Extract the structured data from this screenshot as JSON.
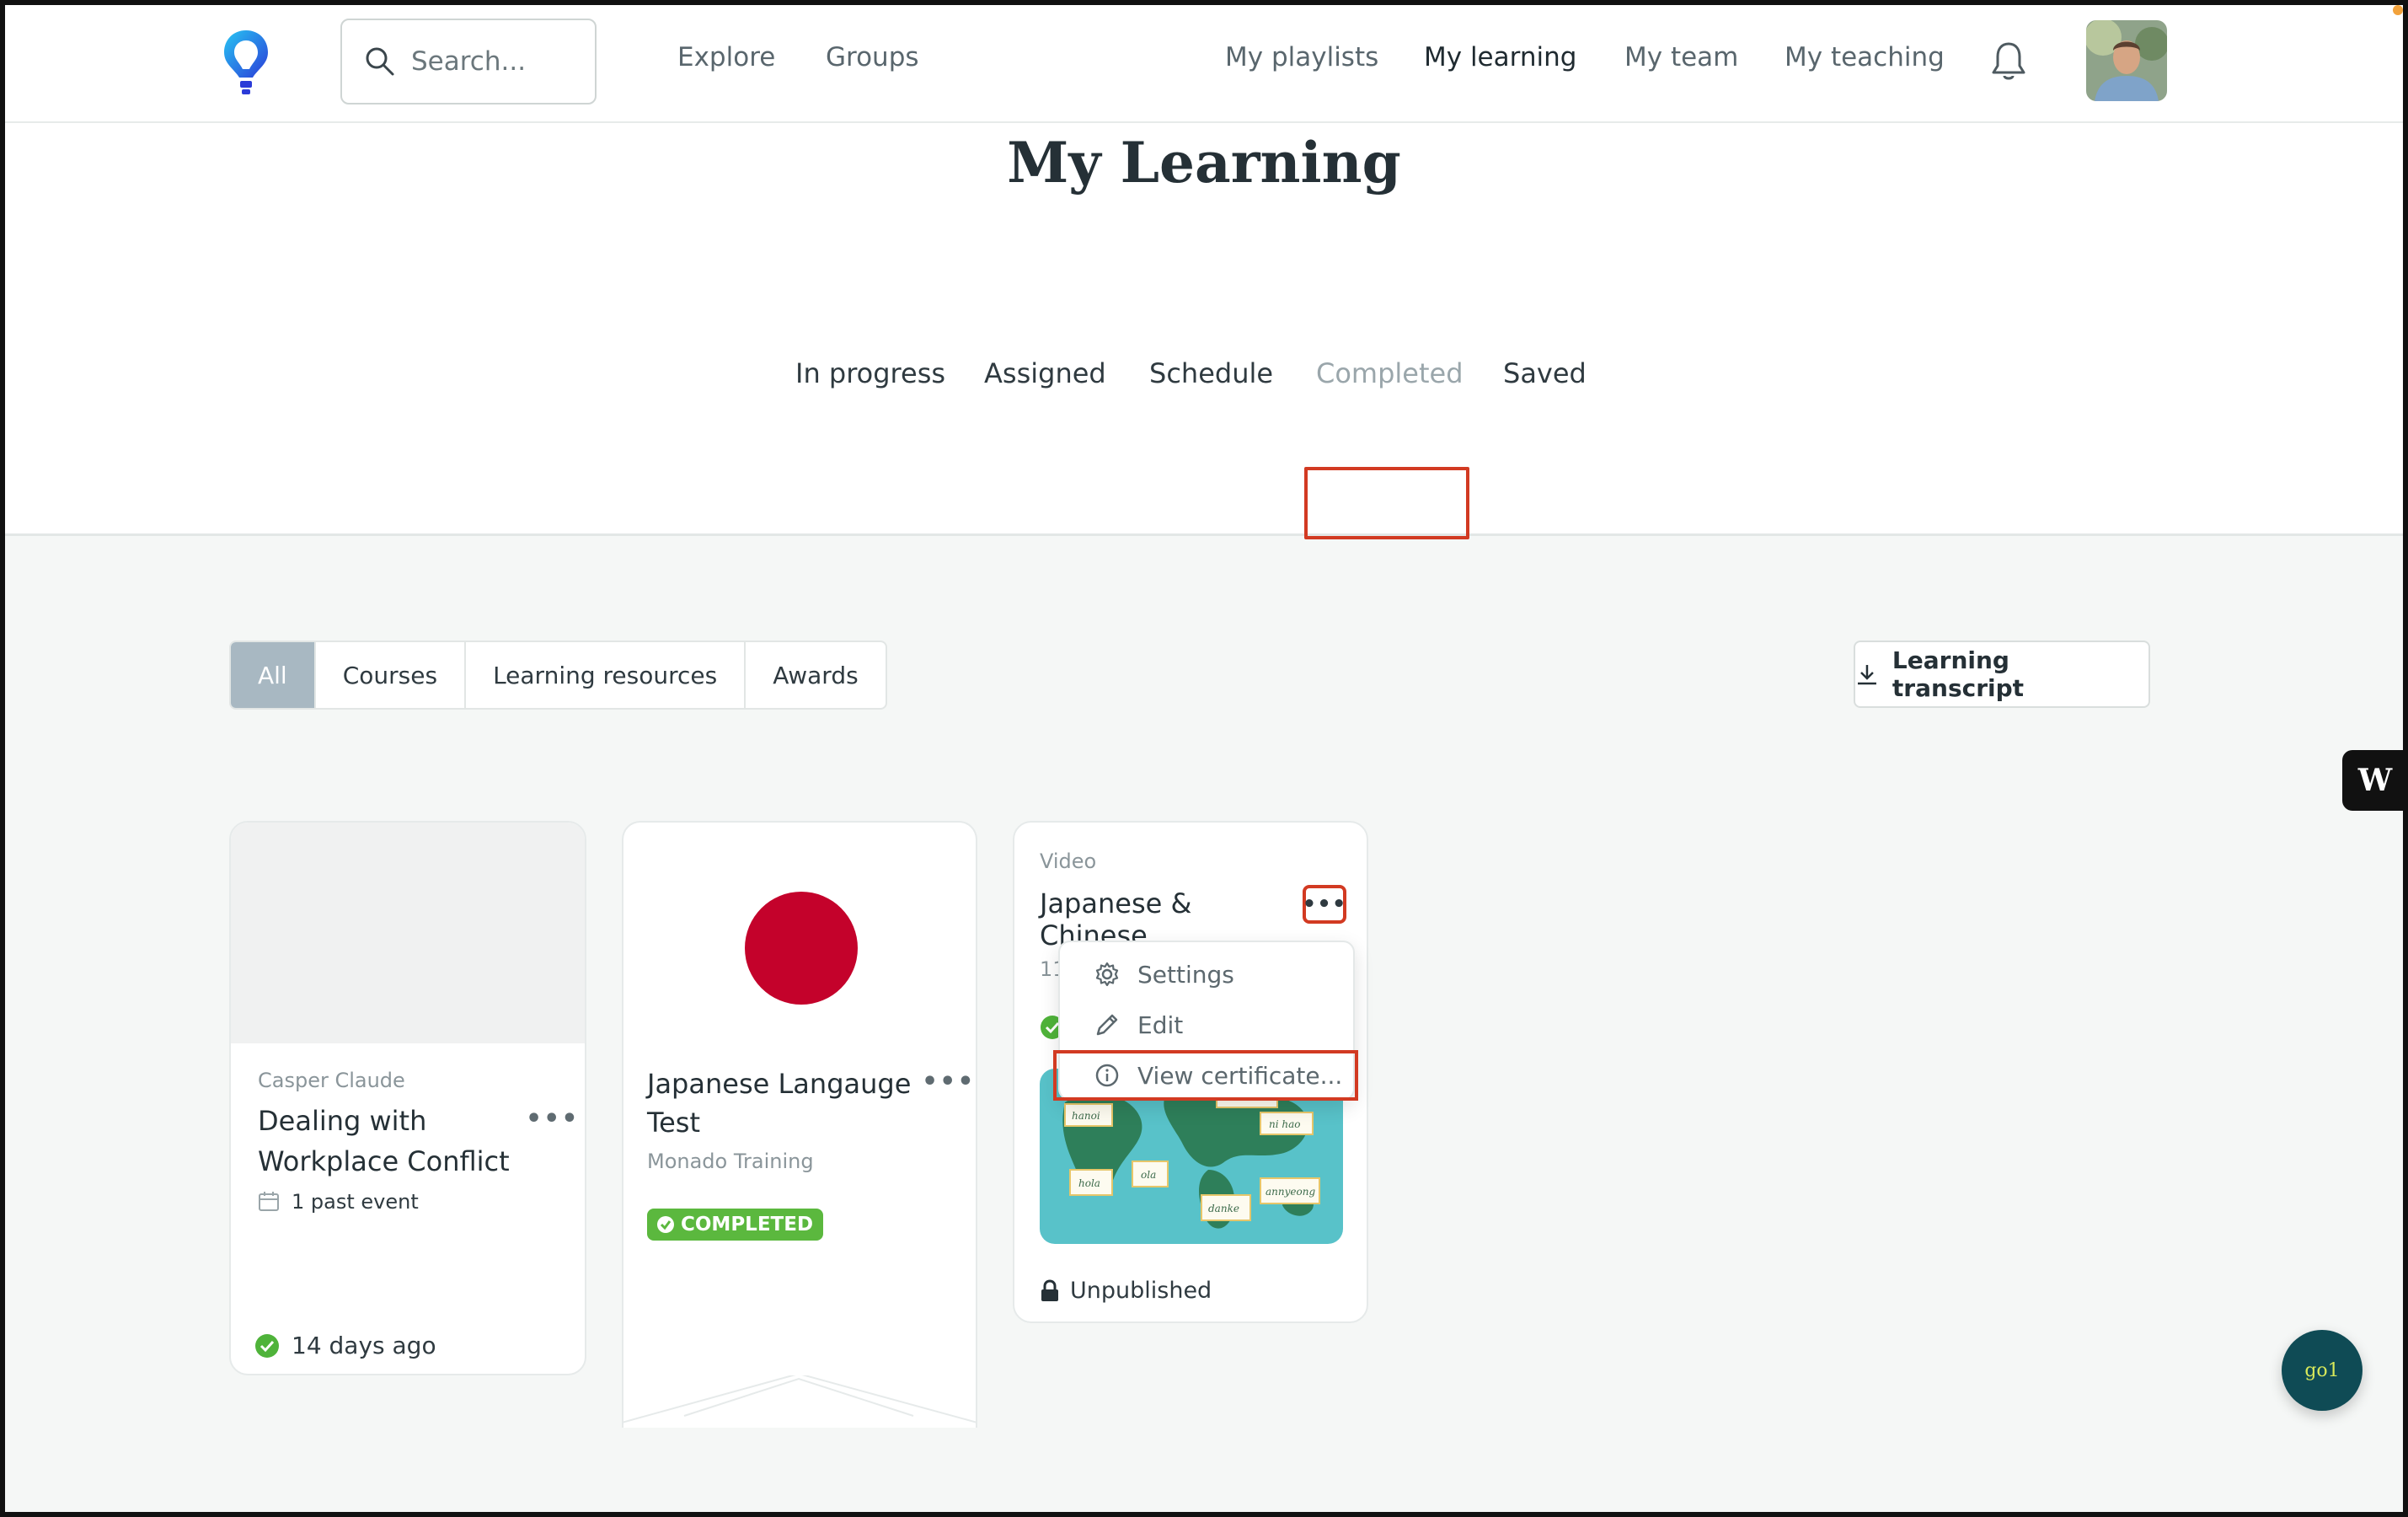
{
  "header": {
    "search_placeholder": "Search...",
    "nav_left": [
      "Explore",
      "Groups"
    ],
    "nav_right": [
      "My playlists",
      "My learning",
      "My team",
      "My teaching"
    ]
  },
  "page": {
    "title": "My Learning",
    "tabs": [
      "In progress",
      "Assigned",
      "Schedule",
      "Completed",
      "Saved"
    ],
    "active_tab": "Completed"
  },
  "filters": {
    "items": [
      "All",
      "Courses",
      "Learning resources",
      "Awards"
    ],
    "active": "All"
  },
  "transcript_button": "Learning transcript",
  "cards": [
    {
      "provider": "Casper Claude",
      "title_line1": "Dealing with",
      "title_line2": "Workplace Conflict",
      "events": "1 past event",
      "completed_when": "14 days ago"
    },
    {
      "title_line1": "Japanese Langauge",
      "title_line2": "Test",
      "provider": "Monado Training",
      "badge": "COMPLETED"
    },
    {
      "type": "Video",
      "title_line1": "Japanese &",
      "title_line2": "Chinese",
      "partial_meta": "11",
      "status": "Unpublished"
    }
  ],
  "menu": {
    "items": [
      "Settings",
      "Edit",
      "View certificate..."
    ]
  },
  "map_words": [
    "hanoi",
    "hola",
    "ola",
    "ni hao",
    "danke",
    "annyeong",
    "sawatdee"
  ],
  "chat_label": "go1",
  "colors": {
    "highlight": "#d23a22",
    "completed_green": "#5bb83e",
    "filter_active": "#a8b8c2",
    "chat_bg": "#0f4b55",
    "flag_red": "#c4022b"
  }
}
